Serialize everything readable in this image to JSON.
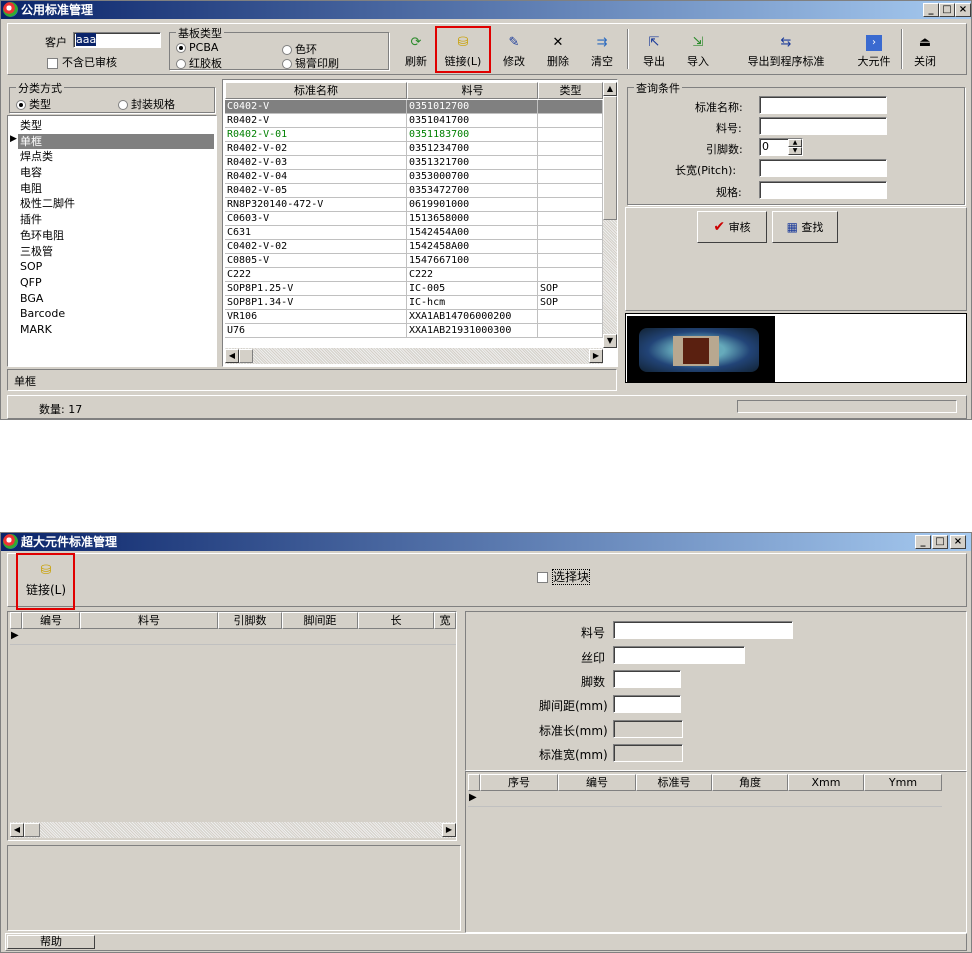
{
  "w1": {
    "title": "公用标准管理",
    "customer_label": "客户",
    "customer_value": "aaa",
    "not_audited_label": "不含已审核",
    "board_group_label": "基板类型",
    "board_options": [
      "PCBA",
      "色环",
      "红胶板",
      "锡膏印刷"
    ],
    "toolbar": {
      "refresh": "刷新",
      "link": "链接(L)",
      "modify": "修改",
      "delete": "删除",
      "clear": "清空",
      "export": "导出",
      "import": "导入",
      "export_program": "导出到程序标准",
      "big_component": "大元件",
      "close": "关闭"
    },
    "category_group_label": "分类方式",
    "category_options": [
      "类型",
      "封装规格"
    ],
    "categories": [
      "类型",
      "单框",
      "焊点类",
      "电容",
      "电阻",
      "极性二脚件",
      "插件",
      "色环电阻",
      "三极管",
      "SOP",
      "QFP",
      "BGA",
      "Barcode",
      "MARK"
    ],
    "table_headers": [
      "标准名称",
      "料号",
      "类型"
    ],
    "rows": [
      [
        "C0402-V",
        "0351012700",
        ""
      ],
      [
        "R0402-V",
        "0351041700",
        ""
      ],
      [
        "R0402-V-01",
        "0351183700",
        ""
      ],
      [
        "R0402-V-02",
        "0351234700",
        ""
      ],
      [
        "R0402-V-03",
        "0351321700",
        ""
      ],
      [
        "R0402-V-04",
        "0353000700",
        ""
      ],
      [
        "R0402-V-05",
        "0353472700",
        ""
      ],
      [
        "RN8P320140-472-V",
        "0619901000",
        ""
      ],
      [
        "C0603-V",
        "1513658000",
        ""
      ],
      [
        "C631",
        "1542454A00",
        ""
      ],
      [
        "C0402-V-02",
        "1542458A00",
        ""
      ],
      [
        "C0805-V",
        "1547667100",
        ""
      ],
      [
        "C222",
        "C222",
        ""
      ],
      [
        "SOP8P1.25-V",
        "IC-005",
        "SOP"
      ],
      [
        "SOP8P1.34-V",
        "IC-hcm",
        "SOP"
      ],
      [
        "VR106",
        "XXA1AB14706000200",
        ""
      ],
      [
        "U76",
        "XXA1AB21931000300",
        ""
      ]
    ],
    "query_group_label": "查询条件",
    "q_name": "标准名称:",
    "q_part": "料号:",
    "q_pins": "引脚数:",
    "q_pins_value": "0",
    "q_pitch": "长宽(Pitch):",
    "q_spec": "规格:",
    "audit_btn": "审核",
    "search_btn": "查找",
    "selected_label": "单框",
    "count_label": "数量: 17"
  },
  "w2": {
    "title": "超大元件标准管理",
    "link_btn": "链接(L)",
    "select_block": "选择块",
    "left_headers": [
      "编号",
      "料号",
      "引脚数",
      "脚间距",
      "长",
      "宽"
    ],
    "f_part": "料号",
    "f_silk": "丝印",
    "f_pins": "脚数",
    "f_pitch": "脚间距(mm)",
    "f_len": "标准长(mm)",
    "f_wid": "标准宽(mm)",
    "right_headers": [
      "序号",
      "编号",
      "标准号",
      "角度",
      "Xmm",
      "Ymm"
    ],
    "help": "帮助"
  },
  "colors": {
    "title_start": "#0a246a",
    "title_end": "#a6caf0",
    "highlight": "#e00000",
    "selected_row": "#808080",
    "green_text": "#008000"
  },
  "icons": {
    "refresh": "refresh-icon",
    "link": "link-icon",
    "modify": "edit-icon",
    "delete": "x-icon",
    "clear": "clear-icon",
    "export": "export-icon",
    "import": "import-icon",
    "close": "door-icon"
  }
}
